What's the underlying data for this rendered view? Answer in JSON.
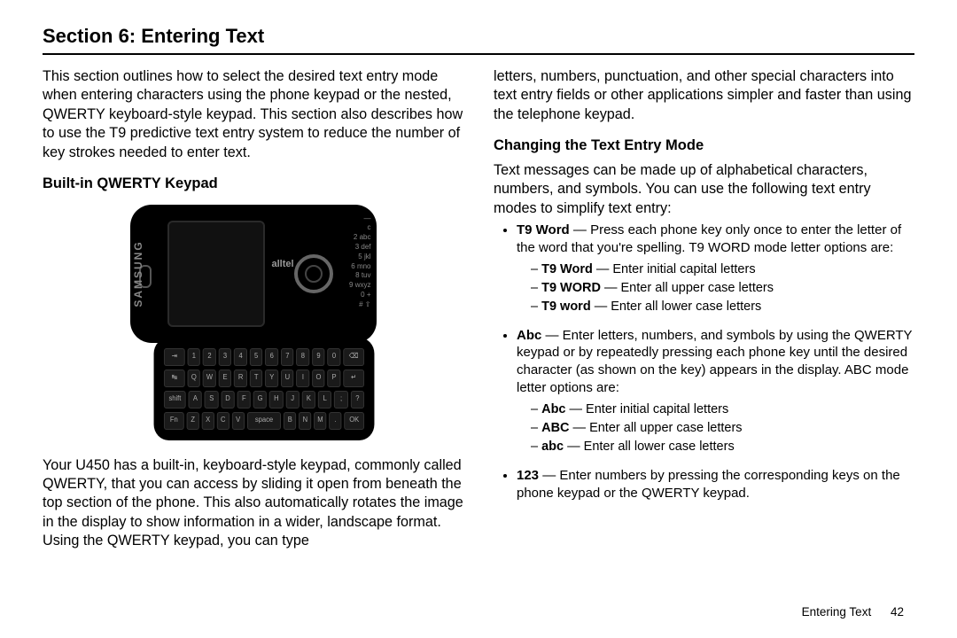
{
  "title": "Section 6: Entering Text",
  "intro": "This section outlines how to select the desired text entry mode when entering characters using the phone keypad or the nested, QWERTY keyboard-style keypad. This section also describes how to use the T9 predictive text entry system to reduce the number of key strokes needed to enter text.",
  "sub1": "Built-in QWERTY Keypad",
  "phone": {
    "brand": "SAMSUNG",
    "carrier": "alltel",
    "numlabels": [
      "—",
      "c",
      "2 abc",
      "3 def",
      "5 jkl",
      "6 mno",
      "8 tuv",
      "9 wxyz",
      "0 +",
      "# ⇧"
    ],
    "row1": [
      "⇥",
      "1",
      "2",
      "3",
      "4",
      "5",
      "6",
      "7",
      "8",
      "9",
      "0",
      "⌫"
    ],
    "row2": [
      "↹",
      "Q",
      "W",
      "E",
      "R",
      "T",
      "Y",
      "U",
      "I",
      "O",
      "P",
      "↵"
    ],
    "row3": [
      "shift",
      "A",
      "S",
      "D",
      "F",
      "G",
      "H",
      "J",
      "K",
      "L",
      ";",
      "?"
    ],
    "row4": [
      "Fn",
      "Z",
      "X",
      "C",
      "V",
      "space",
      "B",
      "N",
      "M",
      ".",
      "OK"
    ]
  },
  "para_qwerty": "Your U450 has a built-in, keyboard-style keypad, commonly called QWERTY, that you can access by sliding it open from beneath the top section of the phone. This also automatically rotates the image in the display to show information in a wider, landscape format. Using the QWERTY keypad, you can type",
  "col2_lead": "letters, numbers, punctuation, and other special characters into text entry fields or other applications simpler and faster than using the telephone keypad.",
  "sub2": "Changing the Text Entry Mode",
  "para_modes": "Text messages can be made up of alphabetical characters, numbers, and symbols. You can use the following text entry modes to simplify text entry:",
  "bullets": {
    "t9_lead_b": "T9 Word",
    "t9_lead": " — Press each phone key only once to enter the letter of the word that you're spelling. T9 WORD mode letter options are:",
    "t9_opts": [
      {
        "b": "T9 Word",
        "t": " — Enter initial capital letters"
      },
      {
        "b": "T9 WORD",
        "t": " — Enter all upper case letters"
      },
      {
        "b": "T9 word",
        "t": " — Enter all lower case letters"
      }
    ],
    "abc_lead_b": "Abc",
    "abc_lead": " — Enter letters, numbers, and symbols by using the QWERTY keypad or by repeatedly pressing each phone key until the desired character (as shown on the key) appears in the display. ABC mode letter options are:",
    "abc_opts": [
      {
        "b": "Abc",
        "t": " — Enter initial capital letters"
      },
      {
        "b": "ABC",
        "t": " — Enter all upper case letters"
      },
      {
        "b": "abc",
        "t": " — Enter all lower case letters"
      }
    ],
    "n123_b": "123",
    "n123": " — Enter numbers by pressing the corresponding keys on the phone keypad or the QWERTY keypad."
  },
  "footer": {
    "label": "Entering Text",
    "page": "42"
  }
}
